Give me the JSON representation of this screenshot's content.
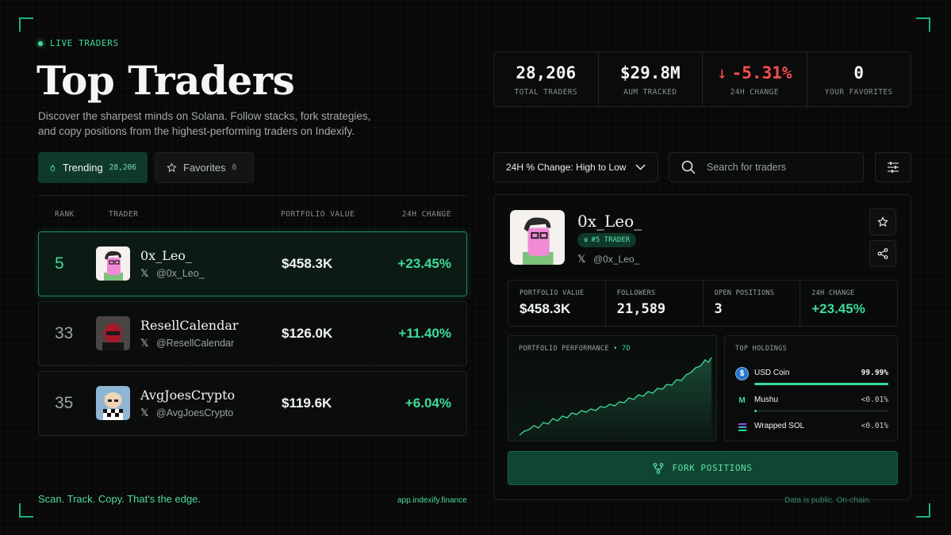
{
  "header": {
    "live_label": "LIVE TRADERS",
    "title": "Top Traders",
    "description": "Discover the sharpest minds on Solana. Follow stacks, fork strategies, and copy positions from the highest-performing traders on Indexify."
  },
  "tabs": {
    "trending": {
      "label": "Trending",
      "count": "28,206"
    },
    "favorites": {
      "label": "Favorites",
      "count": "0"
    }
  },
  "table": {
    "headers": {
      "rank": "RANK",
      "trader": "TRADER",
      "portfolio": "PORTFOLIO VALUE",
      "change": "24H CHANGE"
    },
    "rows": [
      {
        "rank": "5",
        "name": "0x_Leo_",
        "handle": "@0x_Leo_",
        "portfolio": "$458.3K",
        "change": "+23.45%"
      },
      {
        "rank": "33",
        "name": "ResellCalendar",
        "handle": "@ResellCalendar",
        "portfolio": "$126.0K",
        "change": "+11.40%"
      },
      {
        "rank": "35",
        "name": "AvgJoesCrypto",
        "handle": "@AvgJoesCrypto",
        "portfolio": "$119.6K",
        "change": "+6.04%"
      }
    ]
  },
  "stats": {
    "total_traders": {
      "value": "28,206",
      "label": "TOTAL TRADERS"
    },
    "aum": {
      "value": "$29.8M",
      "label": "AUM TRACKED"
    },
    "change": {
      "value": "-5.31%",
      "label": "24H CHANGE"
    },
    "favorites": {
      "value": "0",
      "label": "YOUR FAVORITES"
    }
  },
  "controls": {
    "sort_label": "24H % Change: High to Low",
    "search_placeholder": "Search for traders"
  },
  "detail": {
    "name": "0x_Leo_",
    "badge": "#5 TRADER",
    "handle": "@0x_Leo_",
    "metrics": [
      {
        "label": "PORTFOLIO VALUE",
        "value": "$458.3K"
      },
      {
        "label": "FOLLOWERS",
        "value": "21,589"
      },
      {
        "label": "OPEN POSITIONS",
        "value": "3"
      },
      {
        "label": "24H CHANGE",
        "value": "+23.45%"
      }
    ],
    "performance": {
      "label": "PORTFOLIO PERFORMANCE",
      "sep": "•",
      "timeframe": "7D"
    },
    "holdings": {
      "label": "TOP HOLDINGS",
      "items": [
        {
          "name": "USD Coin",
          "pct": "99.99%",
          "share": 0.9999,
          "icon": "usdc-icon"
        },
        {
          "name": "Mushu",
          "pct": "<0.01%",
          "share": 0.01,
          "icon": "mushu-icon"
        },
        {
          "name": "Wrapped SOL",
          "pct": "<0.01%",
          "share": 0.01,
          "icon": "solana-icon"
        }
      ]
    },
    "fork_label": "FORK POSITIONS"
  },
  "footer": {
    "tagline": "Scan. Track. Copy. That's the edge.",
    "url": "app.indexify.finance",
    "note": "Data is public. On-chain."
  },
  "colors": {
    "accent": "#3ddc97",
    "negative": "#ff4d4f",
    "background": "#070807"
  }
}
